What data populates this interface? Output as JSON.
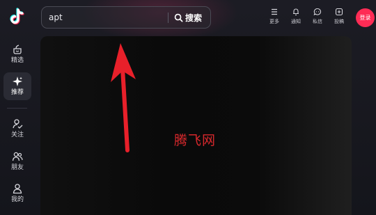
{
  "colors": {
    "accent": "#fe2c55",
    "background": "#16171f",
    "video_bg": "#0b0b0b",
    "annotation": "#e8202a"
  },
  "logo": {
    "icon": "tiktok-logo"
  },
  "sidebar": {
    "items": [
      {
        "label": "精选",
        "icon": "featured-icon",
        "active": false
      },
      {
        "label": "推荐",
        "icon": "sparkle-icon",
        "active": true
      },
      {
        "label": "关注",
        "icon": "follow-icon",
        "active": false
      },
      {
        "label": "朋友",
        "icon": "friends-icon",
        "active": false
      },
      {
        "label": "我的",
        "icon": "profile-icon",
        "active": false
      }
    ]
  },
  "search": {
    "value": "apt",
    "button_label": "搜索",
    "icon": "search-icon"
  },
  "top_actions": [
    {
      "label": "更多",
      "icon": "menu-icon"
    },
    {
      "label": "通知",
      "icon": "bell-icon"
    },
    {
      "label": "私信",
      "icon": "message-icon"
    },
    {
      "label": "投稿",
      "icon": "upload-icon"
    }
  ],
  "login": {
    "label": "登录"
  },
  "video": {
    "watermark": "腾飞网"
  },
  "annotation": {
    "icon": "red-arrow"
  }
}
